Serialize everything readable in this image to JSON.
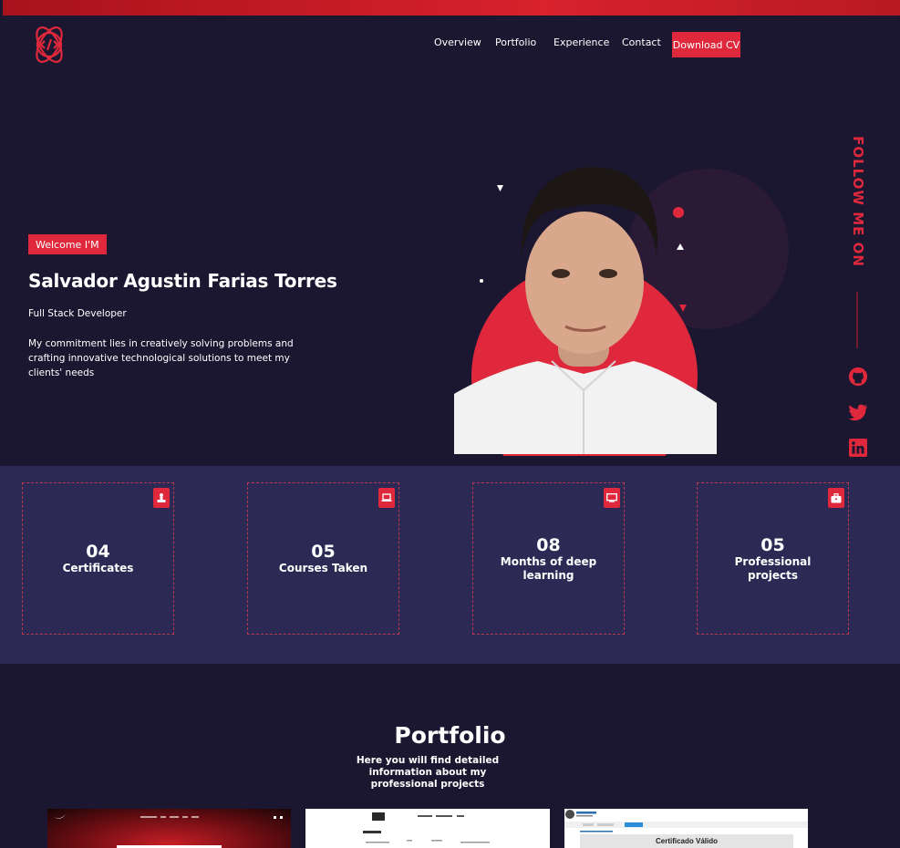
{
  "colors": {
    "background": "#1b1730",
    "accent": "#e0283c",
    "stats_band": "#2c2a54"
  },
  "nav": {
    "logo_icon": "code-atom-icon",
    "links": [
      "Overview",
      "Portfolio",
      "Experience",
      "Contact"
    ],
    "cta_label": "Download CV"
  },
  "hero": {
    "badge": "Welcome I'M",
    "name": "Salvador Agustin Farias Torres",
    "role": "Full Stack Developer",
    "description": "My commitment lies in creatively solving problems and crafting innovative technological solutions to meet my clients' needs"
  },
  "social": {
    "label": "FOLLOW ME ON",
    "icons": [
      "github-icon",
      "twitter-icon",
      "linkedin-icon"
    ]
  },
  "stats": [
    {
      "value": "04",
      "label": "Certificates",
      "icon": "certificate-icon"
    },
    {
      "value": "05",
      "label": "Courses Taken",
      "icon": "laptop-icon"
    },
    {
      "value": "08",
      "label": "Months of deep learning",
      "icon": "monitor-icon"
    },
    {
      "value": "05",
      "label": "Professional projects",
      "icon": "briefcase-icon"
    }
  ],
  "portfolio": {
    "title": "Portfolio",
    "subtitle": "Here you will find detailed information about my professional projects",
    "thumb3_heading": "Certificado Válido"
  }
}
